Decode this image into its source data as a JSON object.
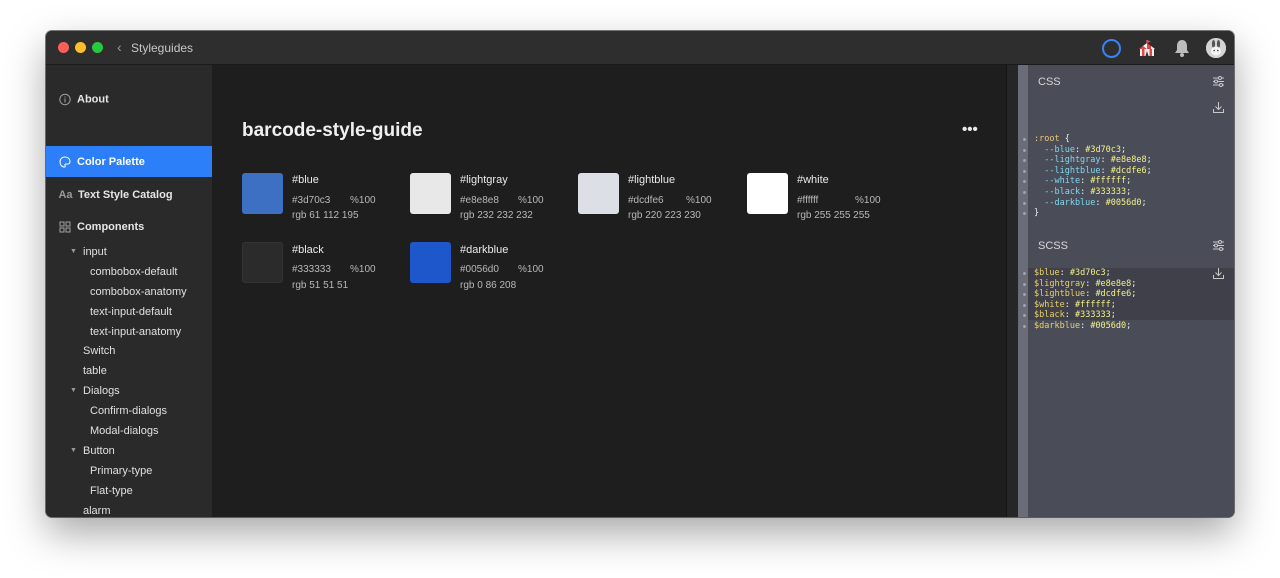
{
  "window": {
    "title": "Styleguides"
  },
  "sidebar": {
    "nav": [
      {
        "label": "About",
        "icon": "info-icon"
      },
      {
        "label": "Color Palette",
        "icon": "palette-icon",
        "active": true
      },
      {
        "label": "Text Style Catalog",
        "icon": "text-style-icon"
      },
      {
        "label": "Components",
        "icon": "components-icon"
      }
    ],
    "tree": [
      {
        "label": "input",
        "expanded": true
      },
      {
        "label": "combobox-default"
      },
      {
        "label": "combobox-anatomy"
      },
      {
        "label": "text-input-default"
      },
      {
        "label": "text-input-anatomy"
      },
      {
        "label": "Switch"
      },
      {
        "label": "table"
      },
      {
        "label": "Dialogs",
        "expanded": true
      },
      {
        "label": "Confirm-dialogs"
      },
      {
        "label": "Modal-dialogs"
      },
      {
        "label": "Button",
        "expanded": true
      },
      {
        "label": "Primary-type"
      },
      {
        "label": "Flat-type"
      },
      {
        "label": "alarm"
      }
    ]
  },
  "main": {
    "title": "barcode-style-guide",
    "more_label": "•••",
    "colors": [
      {
        "name": "#blue",
        "hex": "#3d70c3",
        "opacity": "%100",
        "rgb": "rgb 61 112 195",
        "swatch": "#3d70c3"
      },
      {
        "name": "#lightgray",
        "hex": "#e8e8e8",
        "opacity": "%100",
        "rgb": "rgb 232 232 232",
        "swatch": "#e8e8e8"
      },
      {
        "name": "#lightblue",
        "hex": "#dcdfe6",
        "opacity": "%100",
        "rgb": "rgb 220 223 230",
        "swatch": "#dcdfe6"
      },
      {
        "name": "#white",
        "hex": "#ffffff",
        "opacity": "%100",
        "rgb": "rgb 255 255 255",
        "swatch": "#ffffff"
      },
      {
        "name": "#black",
        "hex": "#333333",
        "opacity": "%100",
        "rgb": "rgb 51 51 51",
        "swatch": "#2b2b2b"
      },
      {
        "name": "#darkblue",
        "hex": "#0056d0",
        "opacity": "%100",
        "rgb": "rgb 0 86 208",
        "swatch": "#1e56cc"
      }
    ]
  },
  "code_panel": {
    "css_label": "CSS",
    "scss_label": "SCSS",
    "css_selector": ":root",
    "css_open": " {",
    "css_close": "}",
    "css_lines": [
      {
        "prop": "  --blue",
        "val": "#3d70c3"
      },
      {
        "prop": "  --lightgray",
        "val": "#e8e8e8"
      },
      {
        "prop": "  --lightblue",
        "val": "#dcdfe6"
      },
      {
        "prop": "  --white",
        "val": "#ffffff"
      },
      {
        "prop": "  --black",
        "val": "#333333"
      },
      {
        "prop": "  --darkblue",
        "val": "#0056d0"
      }
    ],
    "scss_lines": [
      {
        "prop": "$blue",
        "val": "#3d70c3"
      },
      {
        "prop": "$lightgray",
        "val": "#e8e8e8"
      },
      {
        "prop": "$lightblue",
        "val": "#dcdfe6"
      },
      {
        "prop": "$white",
        "val": "#ffffff"
      },
      {
        "prop": "$black",
        "val": "#333333"
      },
      {
        "prop": "$darkblue",
        "val": "#0056d0"
      }
    ],
    "colon": ": ",
    "semicolon": ";"
  }
}
